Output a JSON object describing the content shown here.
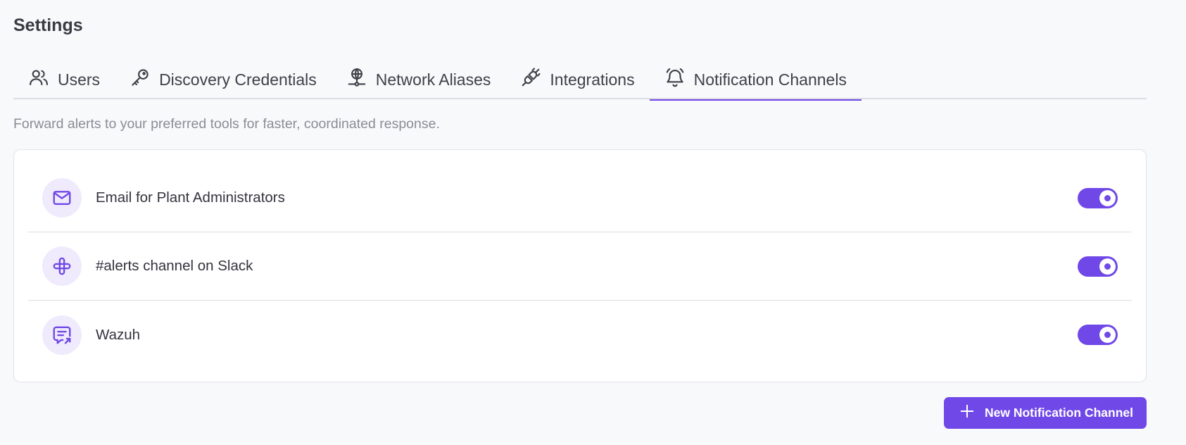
{
  "page": {
    "title": "Settings"
  },
  "tabs": [
    {
      "label": "Users",
      "icon": "users-icon",
      "active": false
    },
    {
      "label": "Discovery Credentials",
      "icon": "key-icon",
      "active": false
    },
    {
      "label": "Network Aliases",
      "icon": "network-icon",
      "active": false
    },
    {
      "label": "Integrations",
      "icon": "plug-icon",
      "active": false
    },
    {
      "label": "Notification Channels",
      "icon": "bell-icon",
      "active": true
    }
  ],
  "subtitle": "Forward alerts to your preferred tools for faster, coordinated response.",
  "channels": [
    {
      "label": "Email for Plant Administrators",
      "icon": "mail-icon",
      "enabled": true
    },
    {
      "label": "#alerts channel on Slack",
      "icon": "slack-icon",
      "enabled": true
    },
    {
      "label": "Wazuh",
      "icon": "message-forward-icon",
      "enabled": true
    }
  ],
  "actions": {
    "new_channel_label": "New Notification Channel",
    "icon": "plus-icon"
  },
  "colors": {
    "accent": "#7048e8",
    "accent_soft": "#efebfd",
    "background": "#f8f9fb"
  }
}
